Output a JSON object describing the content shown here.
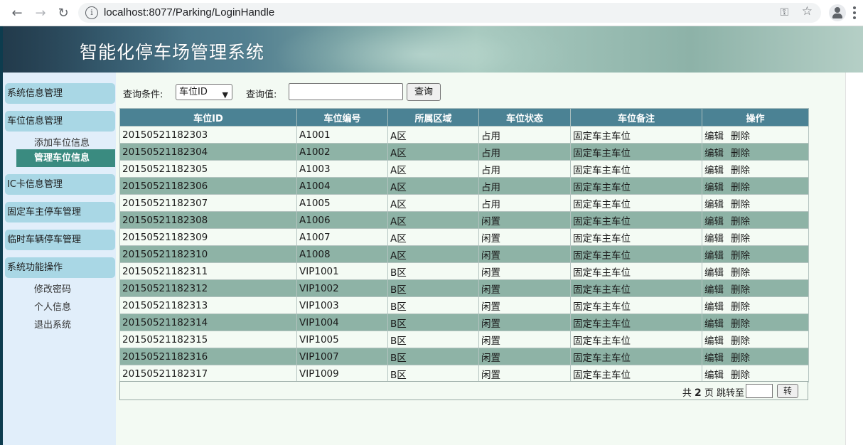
{
  "browser": {
    "url": "localhost:8077/Parking/LoginHandle",
    "back_icon": "arrow-left-icon",
    "forward_icon": "arrow-right-icon",
    "reload_icon": "reload-icon"
  },
  "header": {
    "title": "智能化停车场管理系统"
  },
  "sidebar": {
    "groups": [
      {
        "label": "系统信息管理",
        "items": []
      },
      {
        "label": "车位信息管理",
        "items": [
          "添加车位信息",
          "管理车位信息"
        ]
      },
      {
        "label": "IC卡信息管理",
        "items": []
      },
      {
        "label": "固定车主停车管理",
        "items": []
      },
      {
        "label": "临时车辆停车管理",
        "items": []
      },
      {
        "label": "系统功能操作",
        "items": [
          "修改密码",
          "个人信息",
          "退出系统"
        ]
      }
    ],
    "active_item": "管理车位信息"
  },
  "search": {
    "condition_label": "查询条件:",
    "condition_value": "车位ID",
    "value_label": "查询值:",
    "value": "",
    "button_label": "查询"
  },
  "table": {
    "headers": [
      "车位ID",
      "车位编号",
      "所属区域",
      "车位状态",
      "车位备注",
      "操作"
    ],
    "edit_label": "编辑",
    "delete_label": "删除",
    "rows": [
      [
        "2015052118​2303",
        "A1001",
        "A区",
        "占用",
        "固定车主车位"
      ],
      [
        "20150521182304",
        "A1002",
        "A区",
        "占用",
        "固定车主车位"
      ],
      [
        "20150521182305",
        "A1003",
        "A区",
        "占用",
        "固定车主车位"
      ],
      [
        "20150521182306",
        "A1004",
        "A区",
        "占用",
        "固定车主车位"
      ],
      [
        "20150521182307",
        "A1005",
        "A区",
        "占用",
        "固定车主车位"
      ],
      [
        "20150521182308",
        "A1006",
        "A区",
        "闲置",
        "固定车主车位"
      ],
      [
        "20150521182309",
        "A1007",
        "A区",
        "闲置",
        "固定车主车位"
      ],
      [
        "20150521182310",
        "A1008",
        "A区",
        "闲置",
        "固定车主车位"
      ],
      [
        "20150521182311",
        "VIP1001",
        "B区",
        "闲置",
        "固定车主车位"
      ],
      [
        "20150521182312",
        "VIP1002",
        "B区",
        "闲置",
        "固定车主车位"
      ],
      [
        "20150521182313",
        "VIP1003",
        "B区",
        "闲置",
        "固定车主车位"
      ],
      [
        "20150521182314",
        "VIP1004",
        "B区",
        "闲置",
        "固定车主车位"
      ],
      [
        "20150521182315",
        "VIP1005",
        "B区",
        "闲置",
        "固定车主车位"
      ],
      [
        "20150521182316",
        "VIP1007",
        "B区",
        "闲置",
        "固定车主车位"
      ],
      [
        "20150521182317",
        "VIP1009",
        "B区",
        "闲置",
        "固定车主车位"
      ]
    ]
  },
  "pager": {
    "prefix": "共",
    "total_pages": "2",
    "suffix": "页 跳转至",
    "jump_value": "",
    "go_label": "转"
  }
}
